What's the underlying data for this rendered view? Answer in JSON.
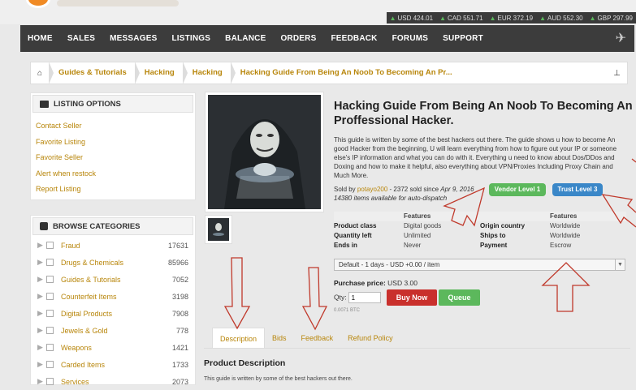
{
  "ticker": [
    {
      "label": "USD 424.01"
    },
    {
      "label": "CAD 551.71"
    },
    {
      "label": "EUR 372.19"
    },
    {
      "label": "AUD 552.30"
    },
    {
      "label": "GBP 297.99"
    }
  ],
  "nav": {
    "items": [
      "HOME",
      "SALES",
      "MESSAGES",
      "LISTINGS",
      "BALANCE",
      "ORDERS",
      "FEEDBACK",
      "FORUMS",
      "SUPPORT"
    ]
  },
  "breadcrumb": [
    "Guides & Tutorials",
    "Hacking",
    "Hacking",
    "Hacking Guide From Being An Noob To Becoming An Pr..."
  ],
  "listing_options": {
    "title": "LISTING OPTIONS",
    "items": [
      "Contact Seller",
      "Favorite Listing",
      "Favorite Seller",
      "Alert when restock",
      "Report Listing"
    ]
  },
  "categories": {
    "title": "BROWSE CATEGORIES",
    "items": [
      {
        "name": "Fraud",
        "count": "17631"
      },
      {
        "name": "Drugs & Chemicals",
        "count": "85966"
      },
      {
        "name": "Guides & Tutorials",
        "count": "7052"
      },
      {
        "name": "Counterfeit Items",
        "count": "3198"
      },
      {
        "name": "Digital Products",
        "count": "7908"
      },
      {
        "name": "Jewels & Gold",
        "count": "778"
      },
      {
        "name": "Weapons",
        "count": "1421"
      },
      {
        "name": "Carded Items",
        "count": "1733"
      },
      {
        "name": "Services",
        "count": "2073"
      }
    ]
  },
  "product": {
    "title": "Hacking Guide From Being An Noob To Becoming An Proffessional Hacker.",
    "description": "This guide is written by some of the best hackers out there. The guide shows u how to become An good Hacker from the beginning, U will learn everything from how to figure out your IP or someone else's IP information and what you can do with it. Everything u need to know about Dos/DDos and Doxing and how to make it helpful, also everything about VPN/Proxies Including Proxy Chain and Much More.",
    "sold_by_prefix": "Sold by",
    "vendor": "potayo200",
    "sold_info": "- 2372 sold since",
    "since_date": "Apr 9, 2016",
    "availability": "14380 items available for auto-dispatch",
    "vendor_level": "Vendor Level 1",
    "trust_level": "Trust Level 3",
    "vendor_level_color": "#5cb85c",
    "trust_level_color": "#3a87c8",
    "features_header": "Features",
    "features": [
      {
        "k": "Product class",
        "v": "Digital goods",
        "k2": "Origin country",
        "v2": "Worldwide"
      },
      {
        "k": "Quantity left",
        "v": "Unlimited",
        "k2": "Ships to",
        "v2": "Worldwide"
      },
      {
        "k": "Ends in",
        "v": "Never",
        "k2": "Payment",
        "v2": "Escrow"
      }
    ],
    "shipping_option": "Default - 1 days - USD +0.00 / item",
    "purchase_price_label": "Purchase price:",
    "purchase_price": "USD 3.00",
    "qty_label": "Qty:",
    "qty_value": "1",
    "btc": "0.0071 BTC",
    "buy_now": "Buy Now",
    "queue": "Queue",
    "buy_color": "#c9302c",
    "queue_color": "#5cb85c"
  },
  "tabs": [
    "Description",
    "Bids",
    "Feedback",
    "Refund Policy"
  ],
  "product_description": {
    "heading": "Product Description",
    "text": "This guide is written by some of the best hackers out there."
  }
}
